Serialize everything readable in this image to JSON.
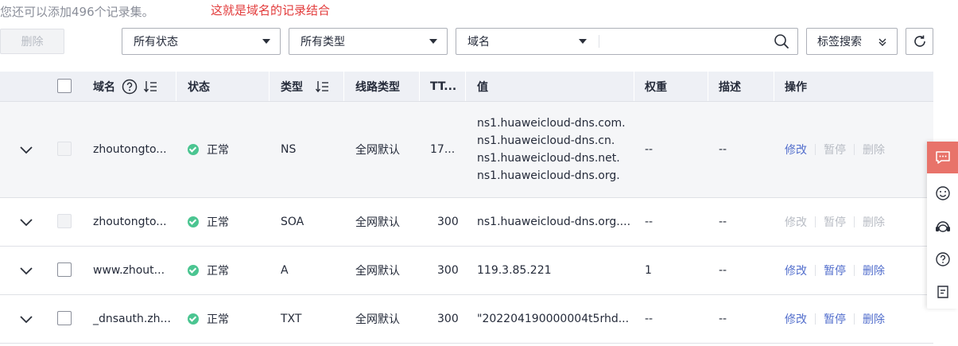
{
  "notes": {
    "quota": "您还可以添加496个记录集。",
    "annotation": "这就是域名的记录结合"
  },
  "toolbar": {
    "delete_label": "删除",
    "status_filter": "所有状态",
    "type_filter": "所有类型",
    "search_field": "域名",
    "search_value": "",
    "tag_search_label": "标签搜索"
  },
  "table": {
    "headers": {
      "domain": "域名",
      "status": "状态",
      "type": "类型",
      "line": "线路类型",
      "ttl": "TT...",
      "value": "值",
      "weight": "权重",
      "desc": "描述",
      "ops": "操作"
    },
    "ops_labels": {
      "edit": "修改",
      "pause": "暂停",
      "delete": "删除"
    },
    "rows": [
      {
        "domain": "zhoutongto...",
        "status": "正常",
        "type": "NS",
        "line": "全网默认",
        "ttl": "17...",
        "value_lines": [
          "ns1.huaweicloud-dns.com.",
          "ns1.huaweicloud-dns.cn.",
          "ns1.huaweicloud-dns.net.",
          "ns1.huaweicloud-dns.org."
        ],
        "weight": "--",
        "desc": "--",
        "ops_enabled": {
          "edit": true,
          "pause": false,
          "delete": false
        },
        "checkbox_disabled": true
      },
      {
        "domain": "zhoutongto...",
        "status": "正常",
        "type": "SOA",
        "line": "全网默认",
        "ttl": "300",
        "value_lines": [
          "ns1.huaweicloud-dns.org...."
        ],
        "weight": "--",
        "desc": "--",
        "ops_enabled": {
          "edit": false,
          "pause": false,
          "delete": false
        },
        "checkbox_disabled": true
      },
      {
        "domain": "www.zhout...",
        "status": "正常",
        "type": "A",
        "line": "全网默认",
        "ttl": "300",
        "value_lines": [
          "119.3.85.221"
        ],
        "weight": "1",
        "desc": "--",
        "ops_enabled": {
          "edit": true,
          "pause": true,
          "delete": true
        },
        "checkbox_disabled": false
      },
      {
        "domain": "_dnsauth.zh...",
        "status": "正常",
        "type": "TXT",
        "line": "全网默认",
        "ttl": "300",
        "value_lines": [
          "\"202204190000004t5rhd..."
        ],
        "weight": "--",
        "desc": "--",
        "ops_enabled": {
          "edit": true,
          "pause": true,
          "delete": true
        },
        "checkbox_disabled": false
      }
    ]
  },
  "colors": {
    "accent": "#526ecc",
    "status_ok": "#4bc591",
    "annotation": "#e23b3b",
    "float_chat": "#e8736a"
  },
  "float_panel": {
    "icons": [
      "chat-icon",
      "smile-icon",
      "headset-icon",
      "help-icon",
      "feedback-icon"
    ]
  }
}
